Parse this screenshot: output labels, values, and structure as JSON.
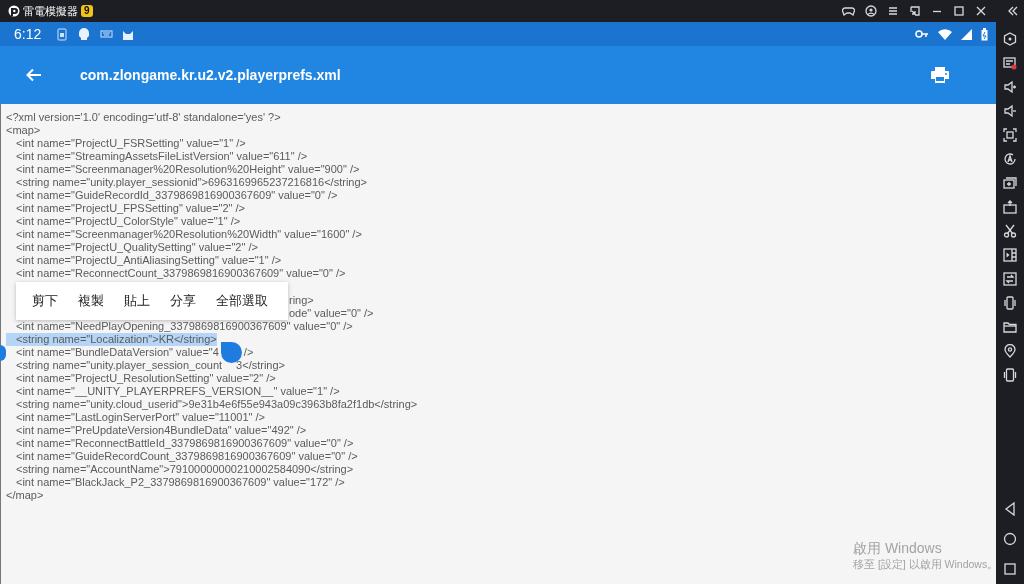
{
  "emulator": {
    "title": "雷電模擬器",
    "version_badge": "9"
  },
  "status_bar": {
    "time": "6:12"
  },
  "app_bar": {
    "title": "com.zlongame.kr.u2.v2.playerprefs.xml"
  },
  "xml": {
    "declaration": "<?xml version='1.0' encoding='utf-8' standalone='yes' ?>",
    "open_tag": "<map>",
    "entries_above": [
      {
        "segments": [
          "<int name=\"ProjectU_FSRSetting\" value=\"1\" />"
        ],
        "selected": false
      },
      {
        "segments": [
          "<int name=\"StreamingAssetsFileListVersion\" value=\"611\" />"
        ],
        "selected": false
      },
      {
        "segments": [
          "<int name=\"Screenmanager%20Resolution%20Height\" value=\"900\" />"
        ],
        "selected": false
      },
      {
        "segments": [
          "<string name=\"unity.player_sessionid\">6963169965237216816</string>"
        ],
        "selected": false
      },
      {
        "segments": [
          "<int name=\"GuideRecordId_3379869816900367609\" value=\"0\" />"
        ],
        "selected": false
      },
      {
        "segments": [
          "<int name=\"ProjectU_FPSSetting\" value=\"2\" />"
        ],
        "selected": false
      },
      {
        "segments": [
          "<int name=\"ProjectU_ColorStyle\" value=\"1\" />"
        ],
        "selected": false
      },
      {
        "segments": [
          "<int name=\"Screenmanager%20Resolution%20Width\" value=\"1600\" />"
        ],
        "selected": false
      },
      {
        "segments": [
          "<int name=\"ProjectU_QualitySetting\" value=\"2\" />"
        ],
        "selected": false
      },
      {
        "segments": [
          "<int name=\"ProjectU_AntiAliasingSetting\" value=\"1\" />"
        ],
        "selected": false
      },
      {
        "segments": [
          "<int name=\"ReconnectCount_3379869816900367609\" value=\"0\" />"
        ],
        "selected": false
      }
    ],
    "context_menu": {
      "items": [
        "剪下",
        "複製",
        "貼上",
        "分享",
        "全部選取"
      ]
    },
    "entries_beside_menu": [
      "ring>",
      "ode\" value=\"0\" />"
    ],
    "entries_below": [
      {
        "segments": [
          "<int name=\"NeedPlayOpening_3379869816900367609\" value=\"0\" />"
        ],
        "selected": false
      },
      {
        "segments": [
          "<string name=\"Localization\">KR</string>"
        ],
        "selected": true
      },
      {
        "segments": [
          "<int name=\"BundleDataVersion\" value=\"4",
          "/>"
        ],
        "selected": false
      },
      {
        "segments": [
          "<string name=\"unity.player_session_count",
          "3</string>"
        ],
        "selected": false
      },
      {
        "segments": [
          "<int name=\"ProjectU_ResolutionSetting\" value=\"2\" />"
        ],
        "selected": false
      },
      {
        "segments": [
          "<int name=\"__UNITY_PLAYERPREFS_VERSION__\" value=\"1\" />"
        ],
        "selected": false
      },
      {
        "segments": [
          "<string name=\"unity.cloud_userid\">9e31b4e6f55e943a09c3963b8fa2f1db</string>"
        ],
        "selected": false
      },
      {
        "segments": [
          "<int name=\"LastLoginServerPort\" value=\"11001\" />"
        ],
        "selected": false
      },
      {
        "segments": [
          "<int name=\"PreUpdateVersion4BundleData\" value=\"492\" />"
        ],
        "selected": false
      },
      {
        "segments": [
          "<int name=\"ReconnectBattleId_3379869816900367609\" value=\"0\" />"
        ],
        "selected": false
      },
      {
        "segments": [
          "<int name=\"GuideRecordCount_3379869816900367609\" value=\"0\" />"
        ],
        "selected": false
      },
      {
        "segments": [
          "<string name=\"AccountName\">79100000000210002584090</string>"
        ],
        "selected": false
      },
      {
        "segments": [
          "<int name=\"BlackJack_P2_3379869816900367609\" value=\"172\" />"
        ],
        "selected": false
      }
    ],
    "close_tag": "</map>"
  },
  "activation_notice": {
    "title": "啟用 Windows",
    "message": "移至 [設定] 以啟用 Windows。"
  }
}
